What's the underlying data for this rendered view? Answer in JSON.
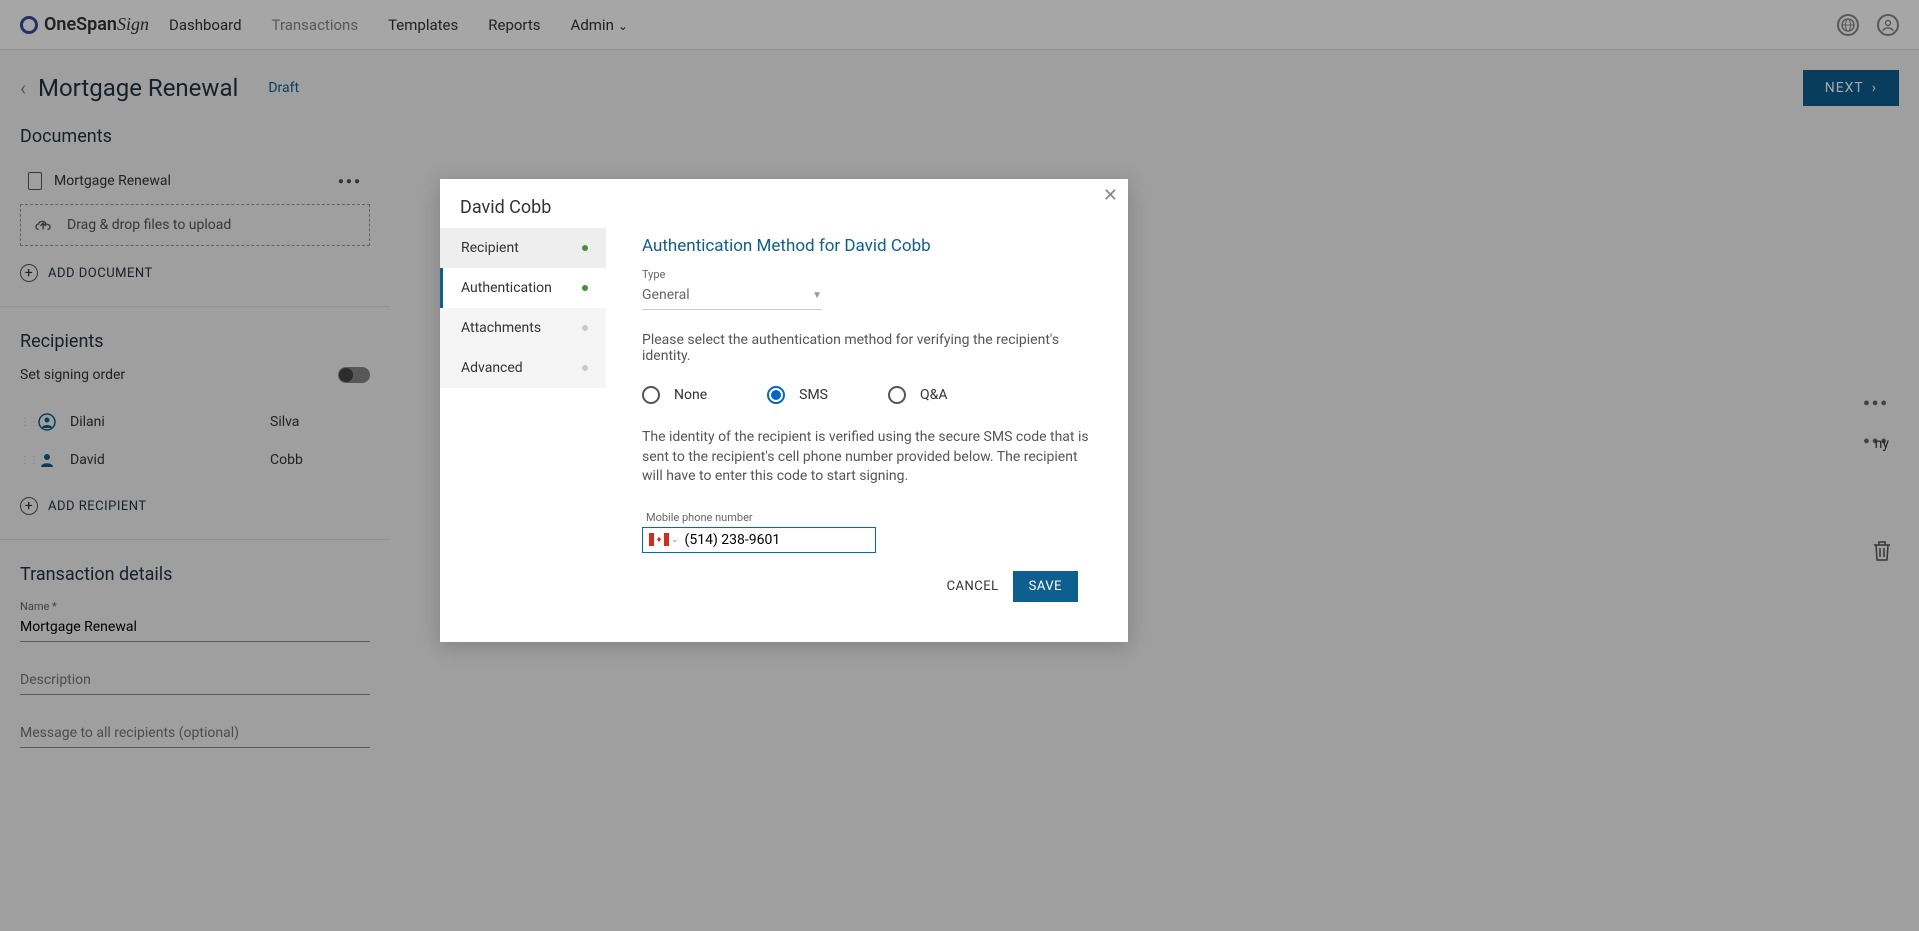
{
  "logo": {
    "brand": "OneSpan",
    "product": "Sign"
  },
  "nav": {
    "dashboard": "Dashboard",
    "transactions": "Transactions",
    "templates": "Templates",
    "reports": "Reports",
    "admin": "Admin"
  },
  "page": {
    "title": "Mortgage Renewal",
    "status": "Draft",
    "next_btn": "NEXT"
  },
  "documents": {
    "section_title": "Documents",
    "items": [
      {
        "name": "Mortgage Renewal"
      }
    ],
    "dropzone_text": "Drag & drop files to upload",
    "add_btn": "ADD DOCUMENT"
  },
  "recipients": {
    "section_title": "Recipients",
    "signing_order_label": "Set signing order",
    "list": [
      {
        "first": "Dilani",
        "last": "Silva"
      },
      {
        "first": "David",
        "last": "Cobb"
      }
    ],
    "add_btn": "ADD RECIPIENT"
  },
  "transaction_details": {
    "section_title": "Transaction details",
    "name_label": "Name *",
    "name_value": "Mortgage Renewal",
    "description_label": "Description",
    "message_label": "Message to all recipients (optional)",
    "extra_text": "ny"
  },
  "modal": {
    "person_name": "David Cobb",
    "tabs": {
      "recipient": "Recipient",
      "authentication": "Authentication",
      "attachments": "Attachments",
      "advanced": "Advanced"
    },
    "auth_title": "Authentication Method for David Cobb",
    "type_label": "Type",
    "type_value": "General",
    "instruction": "Please select the authentication method for verifying the recipient's identity.",
    "options": {
      "none": "None",
      "sms": "SMS",
      "qa": "Q&A"
    },
    "sms_description": "The identity of the recipient is verified using the secure SMS code that is sent to the recipient's cell phone number provided below. The recipient will have to enter this code to start signing.",
    "phone_label": "Mobile phone number",
    "phone_value": "(514) 238-9601",
    "cancel_btn": "CANCEL",
    "save_btn": "SAVE"
  }
}
